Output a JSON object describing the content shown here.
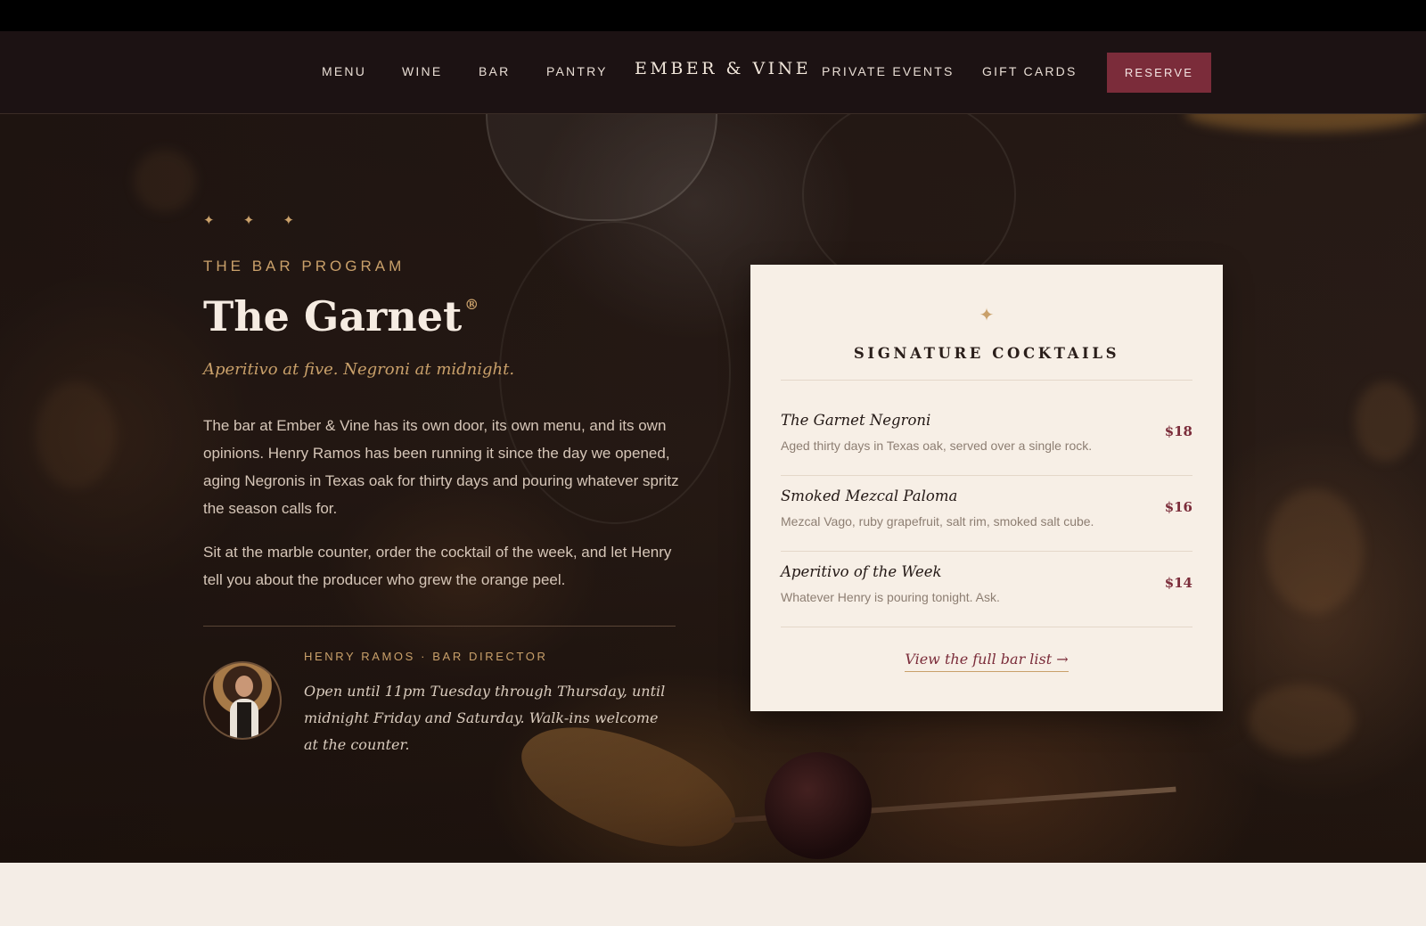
{
  "nav": {
    "links_left": [
      "MENU",
      "WINE",
      "BAR",
      "PANTRY"
    ],
    "brand": "EMBER & VINE",
    "links_right": [
      "PRIVATE EVENTS",
      "GIFT CARDS"
    ],
    "reserve_label": "RESERVE"
  },
  "hero": {
    "stars": "✦ ✦ ✦",
    "eyebrow": "THE BAR PROGRAM",
    "title": "The Garnet",
    "title_mark": "®",
    "tagline": "Aperitivo at five. Negroni at midnight.",
    "paragraphs": [
      "The bar at Ember & Vine has its own door, its own menu, and its own opinions. Henry Ramos has been running it since the day we opened, aging Negronis in Texas oak for thirty days and pouring whatever spritz the season calls for.",
      "Sit at the marble counter, order the cocktail of the week, and let Henry tell you about the producer who grew the orange peel."
    ],
    "person": "HENRY RAMOS · BAR DIRECTOR",
    "quote": "Open until 11pm Tuesday through Thursday, until midnight Friday and Saturday. Walk-ins welcome at the counter."
  },
  "card": {
    "star": "✦",
    "title": "SIGNATURE COCKTAILS",
    "items": [
      {
        "name": "The Garnet Negroni",
        "desc": "Aged thirty days in Texas oak, served over a single rock.",
        "price": "$18"
      },
      {
        "name": "Smoked Mezcal Paloma",
        "desc": "Mezcal Vago, ruby grapefruit, salt rim, smoked salt cube.",
        "price": "$16"
      },
      {
        "name": "Aperitivo of the Week",
        "desc": "Whatever Henry is pouring tonight. Ask.",
        "price": "$14"
      }
    ],
    "full_link": "View the full bar list →"
  },
  "colors": {
    "accent": "#7b2c3a",
    "gold": "#c9a06a",
    "nav_bg": "#1c1213",
    "card_bg": "#f7efe6"
  }
}
